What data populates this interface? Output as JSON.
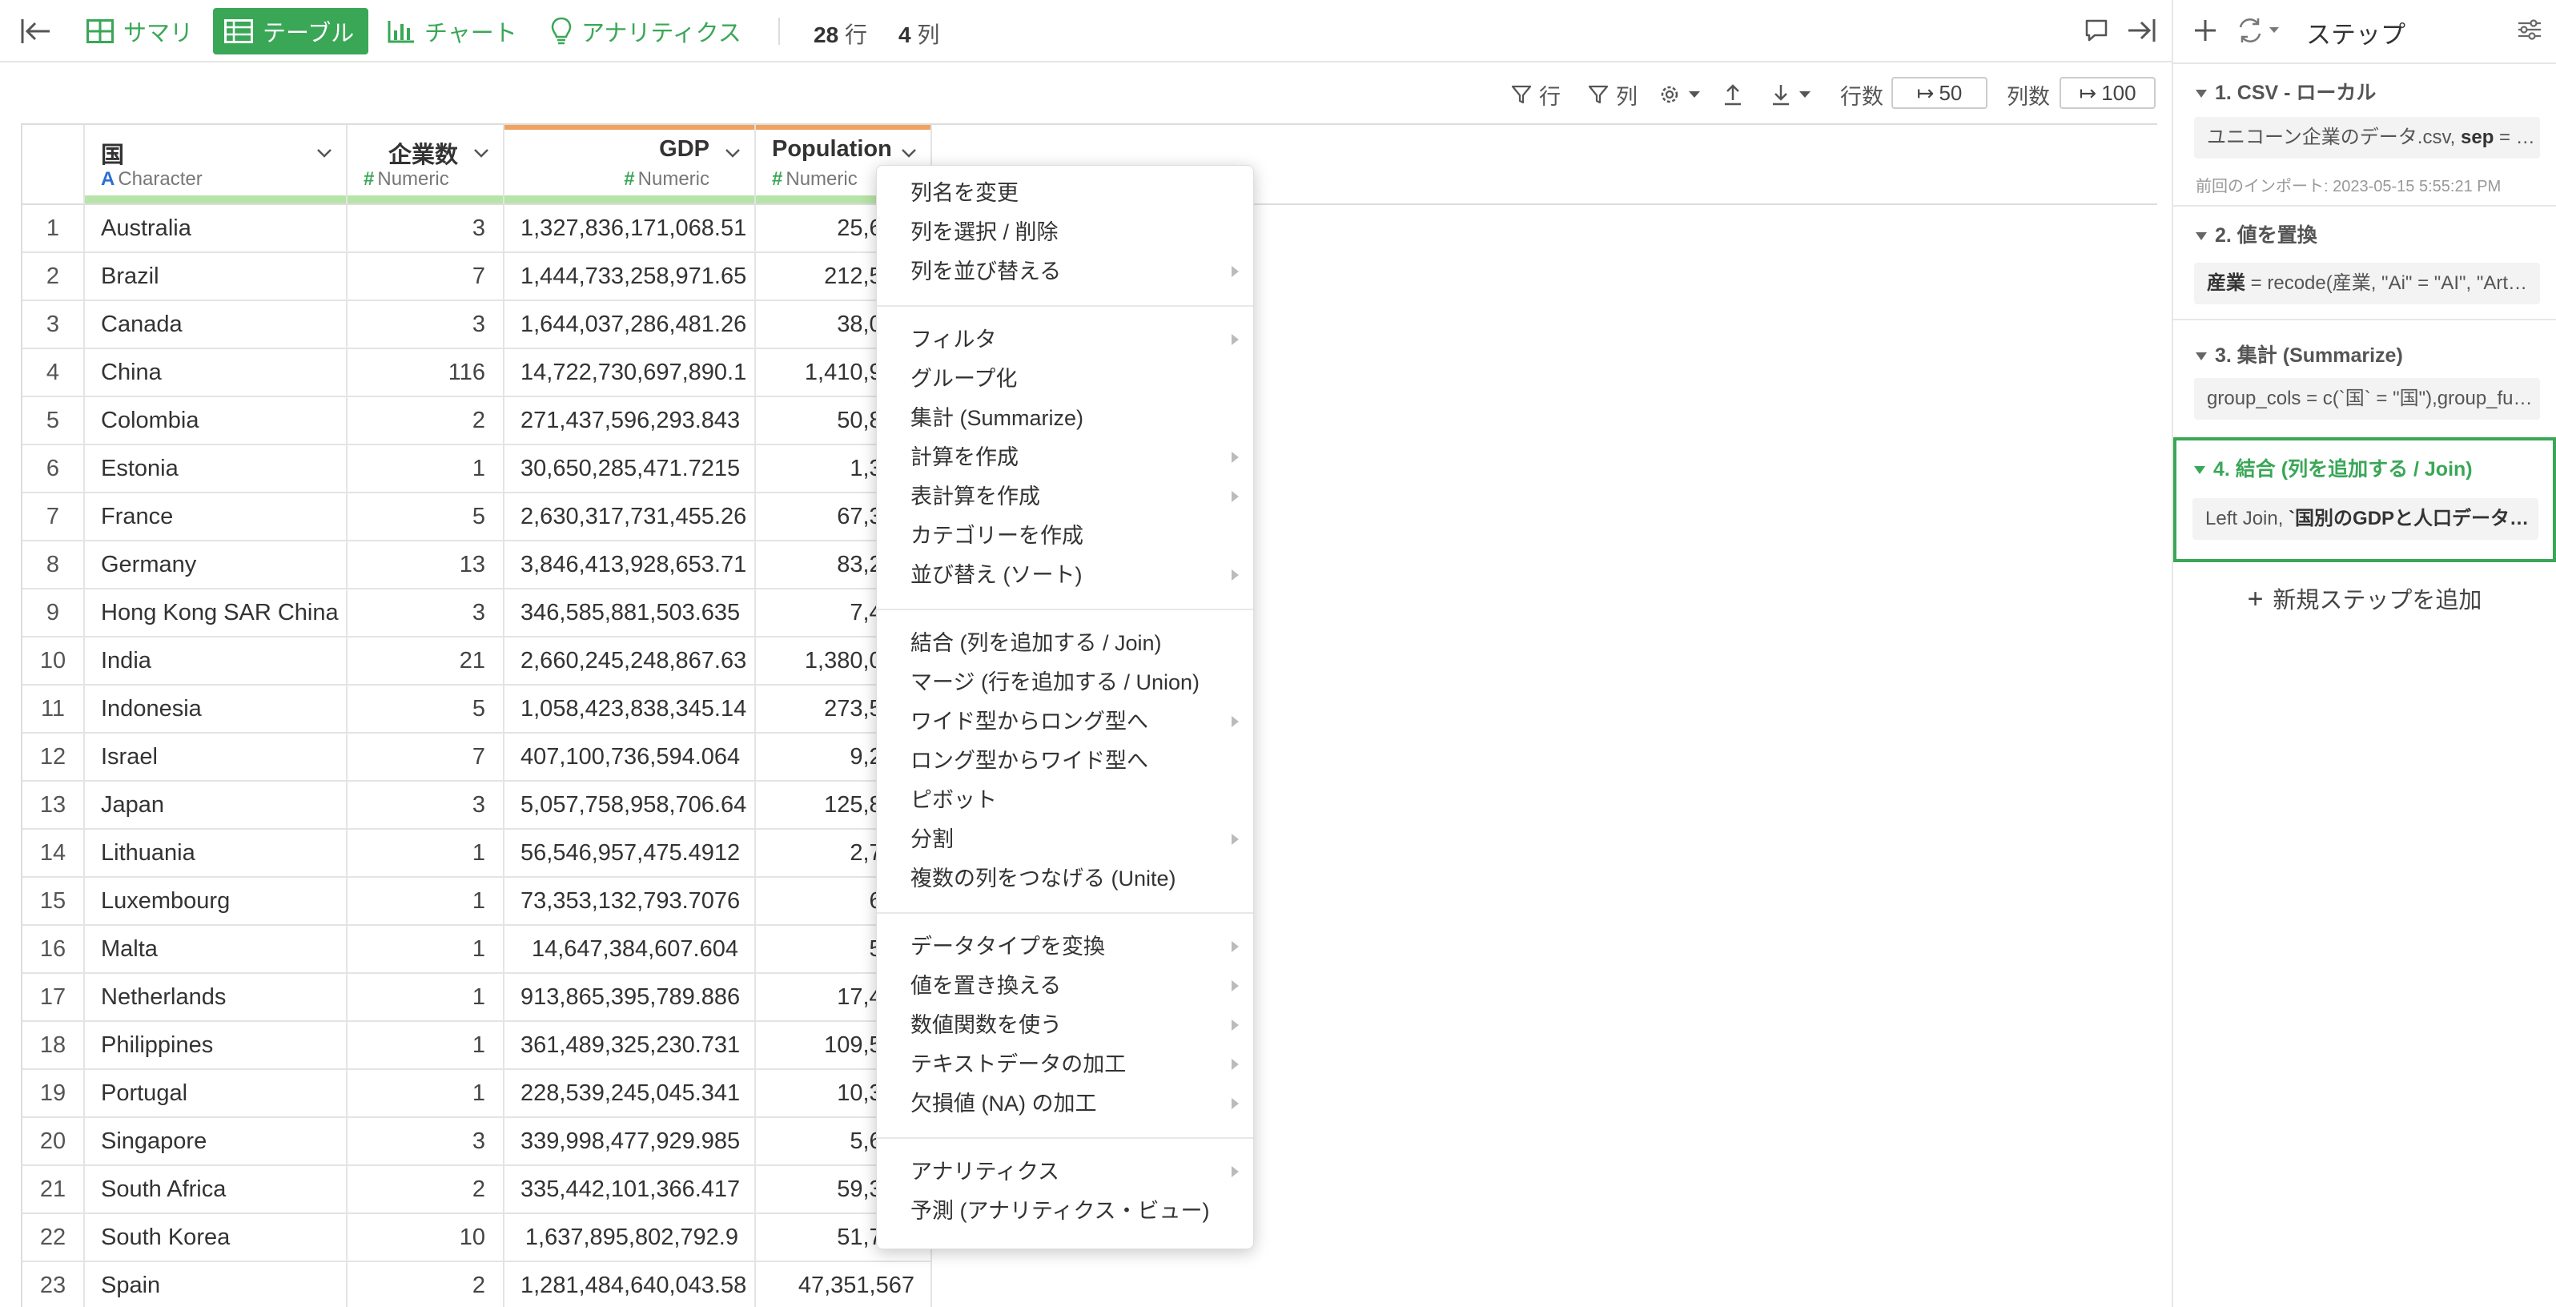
{
  "toolbar": {
    "tabs": [
      {
        "label": "サマリ",
        "icon": "summary-grid-icon"
      },
      {
        "label": "テーブル",
        "icon": "table-icon"
      },
      {
        "label": "チャート",
        "icon": "bar-chart-icon"
      },
      {
        "label": "アナリティクス",
        "icon": "lightbulb-icon"
      }
    ],
    "active_tab": "テーブル",
    "rows_count": "28",
    "rows_unit": "行",
    "cols_count": "4",
    "cols_unit": "列",
    "accent": "#3aa757"
  },
  "subtoolbar": {
    "row_filter": "行",
    "col_filter": "列",
    "rows_label": "行数",
    "rows_value": "50",
    "cols_label": "列数",
    "cols_value": "100"
  },
  "table": {
    "columns": [
      {
        "name": "国",
        "type": "Character",
        "type_glyph": "A"
      },
      {
        "name": "企業数",
        "type": "Numeric",
        "type_glyph": "#"
      },
      {
        "name": "GDP",
        "type": "Numeric",
        "type_glyph": "#"
      },
      {
        "name": "Population",
        "type": "Numeric",
        "type_glyph": "#"
      }
    ],
    "rows": [
      [
        "1",
        "Australia",
        "3",
        "1,327,836,171,068.51",
        "25,687,"
      ],
      [
        "2",
        "Brazil",
        "7",
        "1,444,733,258,971.65",
        "212,559,"
      ],
      [
        "3",
        "Canada",
        "3",
        "1,644,037,286,481.26",
        "38,005,"
      ],
      [
        "4",
        "China",
        "116",
        "14,722,730,697,890.1",
        "1,410,929,"
      ],
      [
        "5",
        "Colombia",
        "2",
        "271,437,596,293.843",
        "50,882,"
      ],
      [
        "6",
        "Estonia",
        "1",
        "30,650,285,471.7215",
        "1,331,"
      ],
      [
        "7",
        "France",
        "5",
        "2,630,317,731,455.26",
        "67,391,"
      ],
      [
        "8",
        "Germany",
        "13",
        "3,846,413,928,653.71",
        "83,240,"
      ],
      [
        "9",
        "Hong Kong SAR China",
        "3",
        "346,585,881,503.635",
        "7,481,"
      ],
      [
        "10",
        "India",
        "21",
        "2,660,245,248,867.63",
        "1,380,004,"
      ],
      [
        "11",
        "Indonesia",
        "5",
        "1,058,423,838,345.14",
        "273,523,"
      ],
      [
        "12",
        "Israel",
        "7",
        "407,100,736,594.064",
        "9,216,"
      ],
      [
        "13",
        "Japan",
        "3",
        "5,057,758,958,706.64",
        "125,836,"
      ],
      [
        "14",
        "Lithuania",
        "1",
        "56,546,957,475.4912",
        "2,794,"
      ],
      [
        "15",
        "Luxembourg",
        "1",
        "73,353,132,793.7076",
        "632,"
      ],
      [
        "16",
        "Malta",
        "1",
        "14,647,384,607.604",
        "525,"
      ],
      [
        "17",
        "Netherlands",
        "1",
        "913,865,395,789.886",
        "17,441,"
      ],
      [
        "18",
        "Philippines",
        "1",
        "361,489,325,230.731",
        "109,581,"
      ],
      [
        "19",
        "Portugal",
        "1",
        "228,539,245,045.341",
        "10,305,"
      ],
      [
        "20",
        "Singapore",
        "3",
        "339,998,477,929.985",
        "5,685,"
      ],
      [
        "21",
        "South Africa",
        "2",
        "335,442,101,366.417",
        "59,308,"
      ],
      [
        "22",
        "South Korea",
        "10",
        "1,637,895,802,792.9",
        "51,780,"
      ],
      [
        "23",
        "Spain",
        "2",
        "1,281,484,640,043.58",
        "47,351,567"
      ]
    ]
  },
  "context_menu": {
    "groups": [
      [
        {
          "label": "列名を変更",
          "submenu": false
        },
        {
          "label": "列を選択 / 削除",
          "submenu": false
        },
        {
          "label": "列を並び替える",
          "submenu": true
        }
      ],
      [
        {
          "label": "フィルタ",
          "submenu": true
        },
        {
          "label": "グループ化",
          "submenu": false
        },
        {
          "label": "集計 (Summarize)",
          "submenu": false
        },
        {
          "label": "計算を作成",
          "submenu": true
        },
        {
          "label": "表計算を作成",
          "submenu": true
        },
        {
          "label": "カテゴリーを作成",
          "submenu": false
        },
        {
          "label": "並び替え (ソート)",
          "submenu": true
        }
      ],
      [
        {
          "label": "結合 (列を追加する / Join)",
          "submenu": false
        },
        {
          "label": "マージ (行を追加する / Union)",
          "submenu": false
        },
        {
          "label": "ワイド型からロング型へ",
          "submenu": true
        },
        {
          "label": "ロング型からワイド型へ",
          "submenu": false
        },
        {
          "label": "ピボット",
          "submenu": false
        },
        {
          "label": "分割",
          "submenu": true
        },
        {
          "label": "複数の列をつなげる (Unite)",
          "submenu": false
        }
      ],
      [
        {
          "label": "データタイプを変換",
          "submenu": true
        },
        {
          "label": "値を置き換える",
          "submenu": true
        },
        {
          "label": "数値関数を使う",
          "submenu": true
        },
        {
          "label": "テキストデータの加工",
          "submenu": true
        },
        {
          "label": "欠損値 (NA) の加工",
          "submenu": true
        }
      ],
      [
        {
          "label": "アナリティクス",
          "submenu": true
        },
        {
          "label": "予測 (アナリティクス・ビュー)",
          "submenu": false
        }
      ]
    ]
  },
  "steps_panel": {
    "title": "ステップ",
    "steps": [
      {
        "header": "1. CSV - ローカル",
        "body_pre": "ユニコーン企業のデータ.csv, ",
        "body_bold": "sep",
        "body_post": " = …",
        "note": "前回のインポート: 2023-05-15 5:55:21 PM",
        "active": false
      },
      {
        "header": "2. 値を置換",
        "body_pre": "",
        "body_bold": "産業",
        "body_post": " = recode(産業, \"Ai\" = \"AI\", \"Art…",
        "note": "",
        "active": false
      },
      {
        "header": "3. 集計 (Summarize)",
        "body_pre": "group_cols = c(`国` = \"国\"),group_fu…",
        "body_bold": "",
        "body_post": "",
        "note": "",
        "active": false
      },
      {
        "header": "4. 結合 (列を追加する / Join)",
        "body_pre": "Left Join, ",
        "body_bold": "`国別のGDPと人口データ…",
        "body_post": "",
        "note": "",
        "active": true
      }
    ],
    "add_step_label": "新規ステップを追加"
  }
}
